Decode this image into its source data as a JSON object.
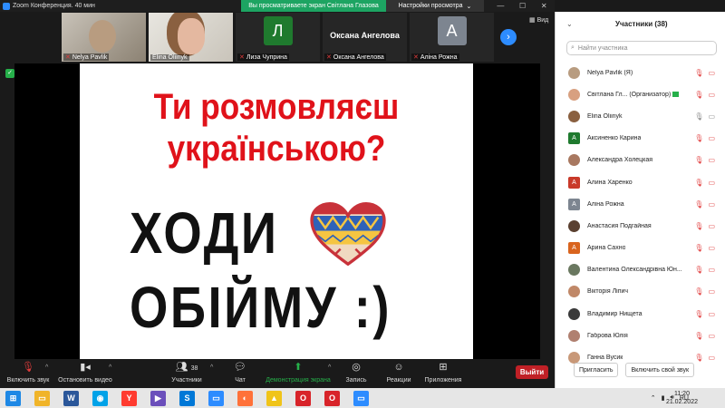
{
  "window": {
    "title": "Zoom Конференция. 40 мин"
  },
  "top_bar": {
    "share_banner": "Вы просматриваете экран Світлана Глазова",
    "view_options": "Настройки просмотра",
    "view_button": "Вид"
  },
  "thumbnails": [
    {
      "name": "Nelya Pavlik",
      "type": "video"
    },
    {
      "name": "Elina Oliinyk",
      "type": "video"
    },
    {
      "name": "Лиза Чуприна",
      "type": "avatar",
      "initial": "Л",
      "color": "#1f7a2e"
    },
    {
      "name": "Оксана Ангелова",
      "type": "name"
    },
    {
      "name": "Аліна Рожна",
      "type": "avatar",
      "initial": "А",
      "color": "#7d8590"
    }
  ],
  "slide": {
    "question_line1": "Ти розмовляєш",
    "question_line2": "українською?",
    "line1": "ХОДИ",
    "line2": "ОБІЙМУ :)"
  },
  "toolbar": {
    "mute": "Включить звук",
    "video": "Остановить видео",
    "participants": "Участники",
    "participants_count": "38",
    "chat": "Чат",
    "share": "Демонстрация экрана",
    "record": "Запись",
    "reactions": "Реакции",
    "apps": "Приложения",
    "leave": "Выйти"
  },
  "panel": {
    "title": "Участники (38)",
    "search_placeholder": "Найти участника",
    "participants": [
      {
        "name": "Nelya Pavlik (Я)",
        "avatar": "photo",
        "color": "#b89c80",
        "mic": "off",
        "video": "off"
      },
      {
        "name": "Світлана Гл... (Организатор)",
        "avatar": "photo",
        "color": "#d8a080",
        "mic": "off",
        "video": "off",
        "host": true
      },
      {
        "name": "Elina Oliinyk",
        "avatar": "photo",
        "color": "#8a6040",
        "mic": "on",
        "video": "on"
      },
      {
        "name": "Аксиненко Карина",
        "avatar": "letter",
        "initial": "А",
        "color": "#1f7a2e",
        "mic": "off",
        "video": "off"
      },
      {
        "name": "Александра Холецкая",
        "avatar": "photo",
        "color": "#a87860",
        "mic": "off",
        "video": "off"
      },
      {
        "name": "Алина Харенко",
        "avatar": "letter",
        "initial": "А",
        "color": "#c93a2a",
        "mic": "off",
        "video": "off"
      },
      {
        "name": "Аліна Рожна",
        "avatar": "letter",
        "initial": "А",
        "color": "#7d8590",
        "mic": "off",
        "video": "off"
      },
      {
        "name": "Анастасия Подгайная",
        "avatar": "photo",
        "color": "#5a4030",
        "mic": "off",
        "video": "off"
      },
      {
        "name": "Арина Сахно",
        "avatar": "letter",
        "initial": "А",
        "color": "#d9641e",
        "mic": "off",
        "video": "off"
      },
      {
        "name": "Валентина Олександрівна Юн...",
        "avatar": "photo",
        "color": "#6a7860",
        "mic": "off",
        "video": "off"
      },
      {
        "name": "Вікторія Ліпич",
        "avatar": "photo",
        "color": "#c08868",
        "mic": "off",
        "video": "off"
      },
      {
        "name": "Владимир Нищета",
        "avatar": "photo",
        "color": "#3a3a3a",
        "mic": "off",
        "video": "off"
      },
      {
        "name": "Габрова Юлія",
        "avatar": "photo",
        "color": "#b08070",
        "mic": "off",
        "video": "off"
      },
      {
        "name": "Ганна Вусик",
        "avatar": "photo",
        "color": "#c89878",
        "mic": "off",
        "video": "off"
      }
    ],
    "invite": "Пригласить",
    "unmute_self": "Включить свой звук"
  },
  "taskbar": {
    "lang": "RU",
    "time": "11:20",
    "date": "21.02.2022"
  }
}
